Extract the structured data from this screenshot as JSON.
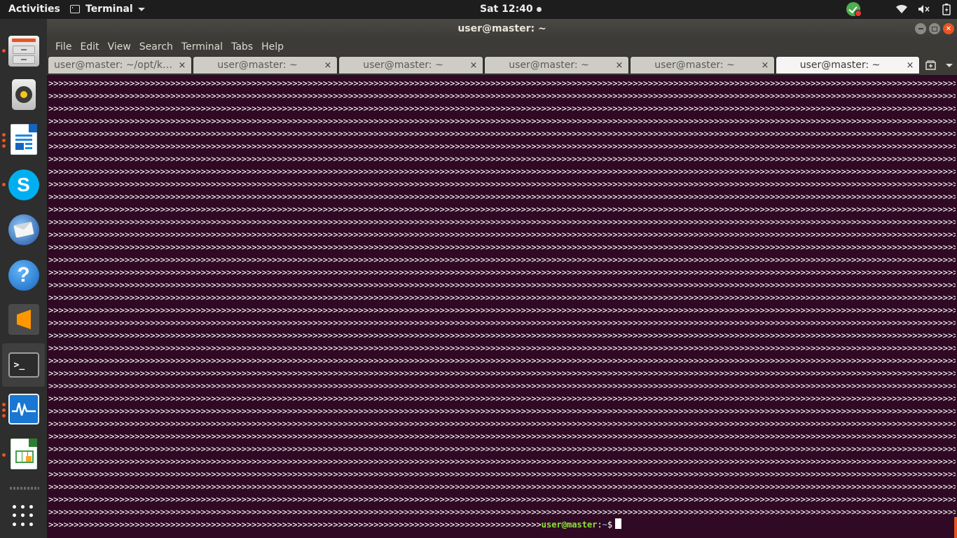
{
  "topbar": {
    "activities": "Activities",
    "app_name": "Terminal",
    "clock": "Sat 12:40",
    "tray_icons": [
      "update-shield-icon",
      "wifi-icon",
      "volume-muted-icon",
      "battery-icon",
      "system-menu-caret-icon"
    ]
  },
  "dock": {
    "items": [
      {
        "name": "Files",
        "icon": "file-cabinet-icon",
        "running": true
      },
      {
        "name": "Rhythmbox",
        "icon": "speaker-icon",
        "running": false
      },
      {
        "name": "LibreOffice Writer",
        "icon": "writer-document-icon",
        "running": true
      },
      {
        "name": "Skype",
        "icon": "skype-icon",
        "running": true,
        "glyph": "S"
      },
      {
        "name": "Thunderbird",
        "icon": "thunderbird-mail-icon",
        "running": false
      },
      {
        "name": "Help",
        "icon": "help-icon",
        "running": false,
        "glyph": "?"
      },
      {
        "name": "Sublime Text",
        "icon": "sublime-text-icon",
        "running": false
      },
      {
        "name": "Terminal",
        "icon": "terminal-icon",
        "running": false,
        "active": true
      },
      {
        "name": "System Monitor",
        "icon": "system-monitor-icon",
        "running": true
      },
      {
        "name": "LibreOffice Calc",
        "icon": "calc-spreadsheet-icon",
        "running": true
      },
      {
        "name": "Show Applications",
        "icon": "app-grid-icon",
        "running": false
      }
    ]
  },
  "window": {
    "title": "user@master: ~",
    "menu": [
      "File",
      "Edit",
      "View",
      "Search",
      "Terminal",
      "Tabs",
      "Help"
    ],
    "tabs": [
      {
        "label": "user@master: ~/opt/k…",
        "active": false
      },
      {
        "label": "user@master: ~",
        "active": false
      },
      {
        "label": "user@master: ~",
        "active": false
      },
      {
        "label": "user@master: ~",
        "active": false
      },
      {
        "label": "user@master: ~",
        "active": false
      },
      {
        "label": "user@master: ~",
        "active": true
      }
    ],
    "tab_close_glyph": "×"
  },
  "terminal": {
    "fill_char": ">",
    "full_line_count": 35,
    "full_line_length": 212,
    "last_line_prefix_length": 97,
    "prompt_user": "user@master",
    "prompt_sep": ":",
    "prompt_path": "~",
    "prompt_symbol": "$"
  },
  "colors": {
    "terminal_bg": "#300a24",
    "prompt_user": "#8ae234",
    "prompt_path": "#729fcf",
    "accent": "#e95420"
  }
}
